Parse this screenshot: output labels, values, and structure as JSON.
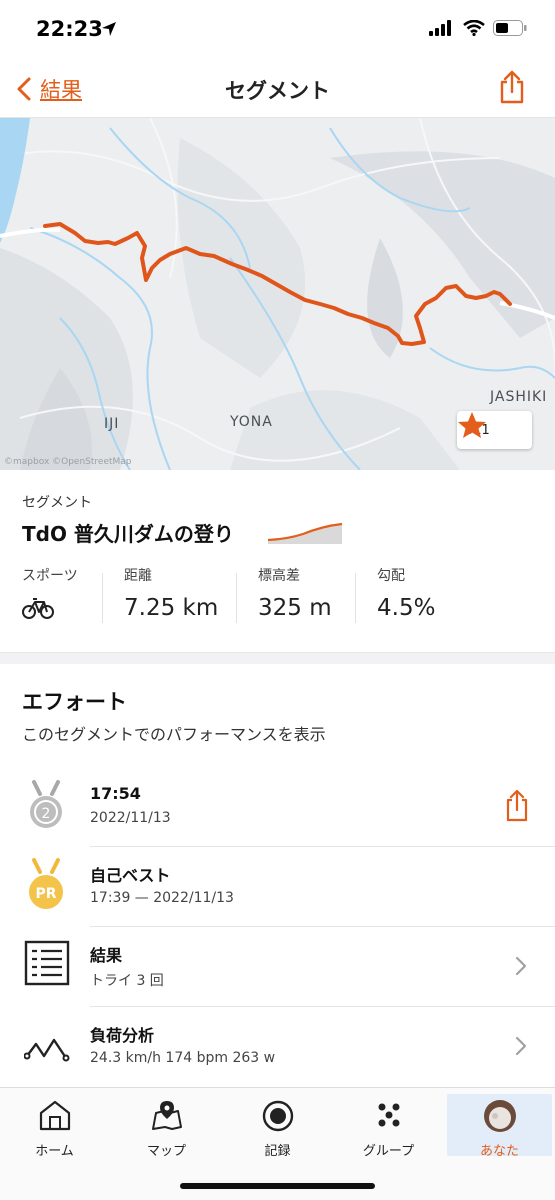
{
  "status": {
    "time": "22:23"
  },
  "nav": {
    "back_label": "結果",
    "title": "セグメント"
  },
  "map": {
    "labels": [
      "IJI",
      "YONA",
      "JASHIKI"
    ],
    "star_count": "311",
    "attribution": "©mapbox ©OpenStreetMap"
  },
  "segment": {
    "kicker": "セグメント",
    "name": "TdO 普久川ダムの登り",
    "stats": [
      {
        "label": "スポーツ",
        "value": ""
      },
      {
        "label": "距離",
        "value": "7.25 km"
      },
      {
        "label": "標高差",
        "value": "325 m"
      },
      {
        "label": "勾配",
        "value": "4.5%"
      }
    ]
  },
  "effort": {
    "title": "エフォート",
    "subtitle": "このセグメントでのパフォーマンスを表示",
    "rows": [
      {
        "title": "17:54",
        "sub": "2022/11/13"
      },
      {
        "title": "自己ベスト",
        "sub": "17:39 — 2022/11/13"
      },
      {
        "title": "結果",
        "sub": "トライ 3 回"
      },
      {
        "title": "負荷分析",
        "sub": "24.3 km/h 174 bpm 263 w"
      }
    ],
    "medal_number": "2",
    "pr_badge": "PR"
  },
  "tabs": [
    {
      "label": "ホーム",
      "icon": "home-icon"
    },
    {
      "label": "マップ",
      "icon": "map-icon"
    },
    {
      "label": "記録",
      "icon": "record-icon"
    },
    {
      "label": "グループ",
      "icon": "groups-icon"
    },
    {
      "label": "あなた",
      "icon": "avatar-icon"
    }
  ],
  "colors": {
    "accent": "#e35e1a",
    "route": "#e0561a",
    "water": "#a9d6f2"
  }
}
